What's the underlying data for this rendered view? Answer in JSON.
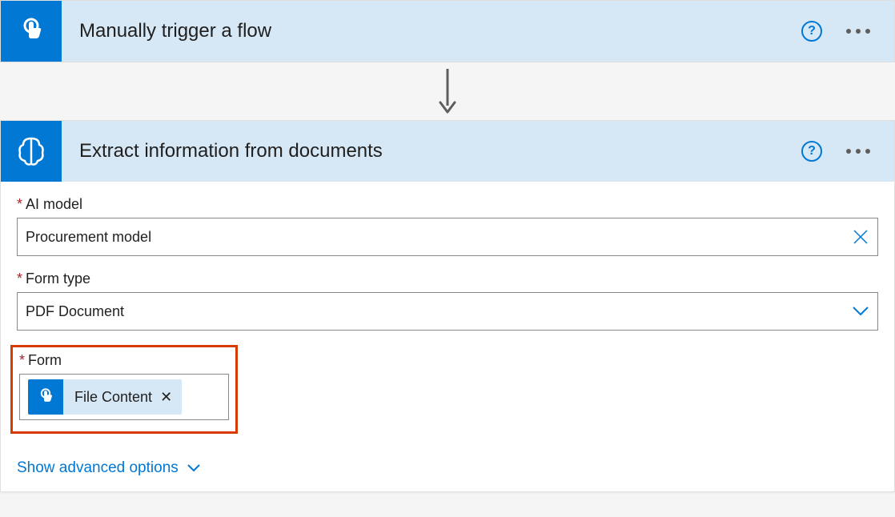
{
  "trigger": {
    "title": "Manually trigger a flow",
    "icon": "touch-icon"
  },
  "action": {
    "title": "Extract information from documents",
    "icon": "ai-brain-icon",
    "fields": {
      "aiModel": {
        "label": "AI model",
        "required": true,
        "value": "Procurement model"
      },
      "formType": {
        "label": "Form type",
        "required": true,
        "value": "PDF Document"
      },
      "form": {
        "label": "Form",
        "required": true,
        "token": {
          "label": "File Content",
          "source": "Manually trigger a flow"
        }
      }
    },
    "advancedLink": "Show advanced options"
  }
}
